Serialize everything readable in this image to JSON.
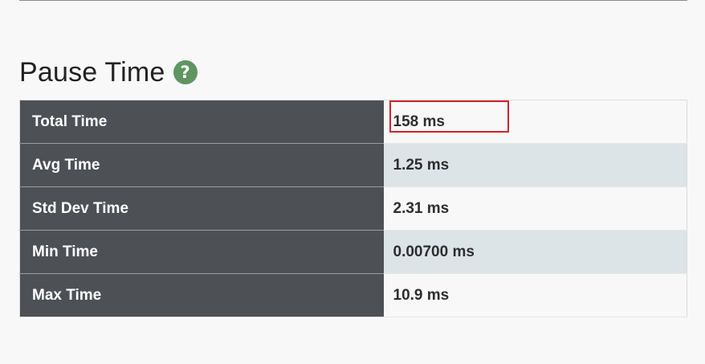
{
  "section": {
    "title": "Pause Time",
    "help_icon": "question-circle-icon"
  },
  "stats": {
    "rows": [
      {
        "label": "Total Time",
        "value": "158 ms"
      },
      {
        "label": "Avg Time",
        "value": "1.25 ms"
      },
      {
        "label": "Std Dev Time",
        "value": "2.31 ms"
      },
      {
        "label": "Min Time",
        "value": "0.00700 ms"
      },
      {
        "label": "Max Time",
        "value": "10.9 ms"
      }
    ]
  },
  "colors": {
    "label_bg": "#4d5055",
    "help_icon": "#5e9561",
    "highlight": "#d4202e",
    "alt_row": "#dde4e8"
  }
}
